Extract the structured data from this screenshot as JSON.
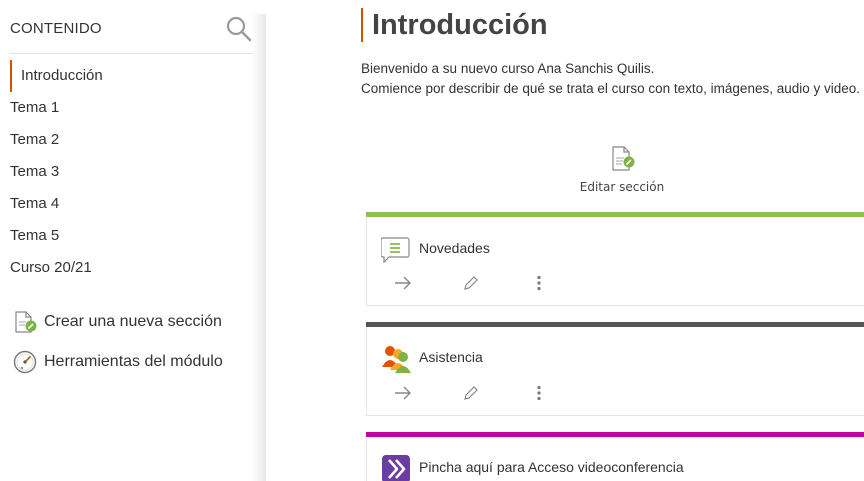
{
  "sidebar": {
    "title": "CONTENIDO",
    "items": [
      {
        "label": "Introducción",
        "active": true
      },
      {
        "label": "Tema 1"
      },
      {
        "label": "Tema 2"
      },
      {
        "label": "Tema 3"
      },
      {
        "label": "Tema 4"
      },
      {
        "label": "Tema 5"
      },
      {
        "label": "Curso 20/21"
      }
    ],
    "tools": {
      "new_section": "Crear una nueva sección",
      "module_tools": "Herramientas del módulo"
    }
  },
  "main": {
    "title": "Introducción",
    "intro_line1": "Bienvenido a su nuevo curso Ana Sanchis Quilis.",
    "intro_line2": "Comience por describir de qué se trata el curso con texto, imágenes, audio y video.",
    "edit_section_label": "Editar sección",
    "cards": [
      {
        "title": "Novedades",
        "bar_color": "#8cc152",
        "icon": "forum-icon"
      },
      {
        "title": "Asistencia",
        "bar_color": "#555555",
        "icon": "attendance-icon"
      },
      {
        "title": "Pincha aquí para Acceso videoconferencia",
        "bar_color": "#c800a1",
        "icon": "video-conference-icon"
      }
    ]
  },
  "colors": {
    "accent": "#d35400",
    "icon_green": "#7cb342"
  }
}
